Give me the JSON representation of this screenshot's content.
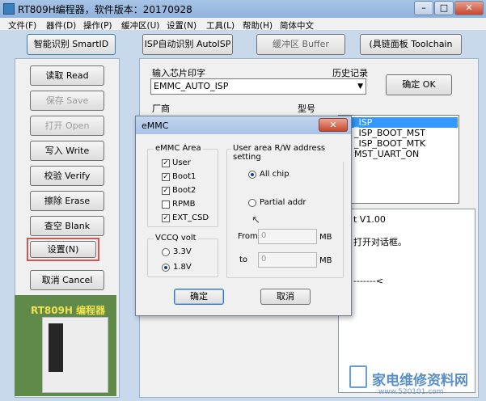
{
  "window": {
    "title": "RT809H编程器，软件版本：20170928"
  },
  "menu": [
    "文件(F)",
    "器件(D)",
    "操作(P)",
    "缓冲区(U)",
    "设置(N)",
    "工具(L)",
    "帮助(H)",
    "简体中文"
  ],
  "toolbar": {
    "smartid": "智能识别 SmartID",
    "autoisp": "ISP自动识别 AutoISP",
    "buffer": "缓冲区 Buffer",
    "toolchain_partial": "(具链面板 Toolchain"
  },
  "sidebar": {
    "read": "读取 Read",
    "save": "保存 Save",
    "open": "打开 Open",
    "write": "写入 Write",
    "verify": "校验 Verify",
    "erase": "擦除 Erase",
    "blank": "查空 Blank",
    "settings": "设置(N)",
    "cancel": "取消 Cancel",
    "logo": "RT809H 编程器"
  },
  "main": {
    "chip_label": "输入芯片印字",
    "history_label": "历史记录",
    "chip_value": "EMMC_AUTO_ISP",
    "ok": "确定 OK",
    "vendor_label": "厂商",
    "model_label": "型号",
    "models": [
      "_ISP",
      "_ISP_BOOT_MST",
      "_ISP_BOOT_MTK",
      "MST_UART_ON"
    ],
    "log_lines": [
      "t V1.00",
      "打开对话框。",
      "-------<"
    ]
  },
  "dialog": {
    "title": "eMMC",
    "area_label": "eMMC Area",
    "areas": [
      {
        "label": "User",
        "checked": true
      },
      {
        "label": "Boot1",
        "checked": true
      },
      {
        "label": "Boot2",
        "checked": true
      },
      {
        "label": "RPMB",
        "checked": false
      },
      {
        "label": "EXT_CSD",
        "checked": true
      }
    ],
    "vccq_label": "VCCQ volt",
    "vccq_options": [
      {
        "label": "3.3V",
        "selected": false
      },
      {
        "label": "1.8V",
        "selected": true
      }
    ],
    "rw_label": "User area R/W address setting",
    "all_chip": "All chip",
    "partial": "Partial addr",
    "from_label": "From",
    "from_value": "0",
    "from_unit": "MB",
    "to_label": "to",
    "to_value": "0",
    "to_unit": "MB",
    "ok": "确定",
    "cancel": "取消"
  },
  "watermark": {
    "text": "家电维修资料网",
    "url": "www.520101.com"
  },
  "colors": {
    "accent": "#d9534f",
    "selection": "#3399ff",
    "panel": "#f0f0f0"
  }
}
